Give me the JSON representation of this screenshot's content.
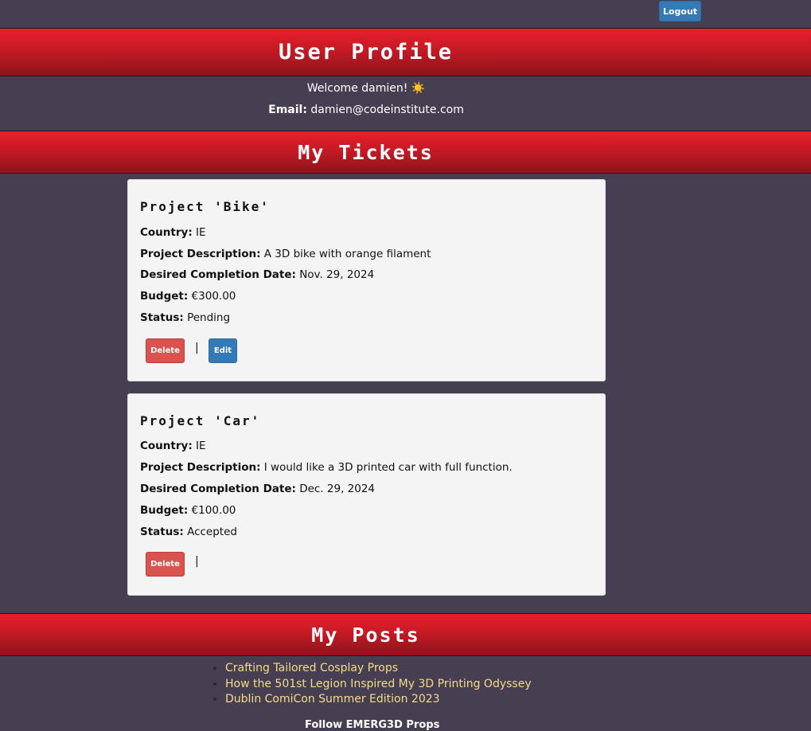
{
  "topbar": {
    "logout_label": "Logout"
  },
  "profile": {
    "title": "User Profile",
    "welcome": "Welcome damien! ☀️",
    "email_label": "Email:",
    "email_value": "damien@codeinstitute.com"
  },
  "tickets": {
    "title": "My Tickets",
    "labels": {
      "country": "Country:",
      "description": "Project Description:",
      "date": "Desired Completion Date:",
      "budget": "Budget:",
      "status": "Status:"
    },
    "separator": "|",
    "delete_label": "Delete",
    "edit_label": "Edit",
    "items": [
      {
        "title": "Project 'Bike'",
        "country": "IE",
        "description": "A 3D bike with orange filament",
        "date": "Nov. 29, 2024",
        "budget": "€300.00",
        "status": "Pending"
      },
      {
        "title": "Project 'Car'",
        "country": "IE",
        "description": "I would like a 3D printed car with full function.",
        "date": "Dec. 29, 2024",
        "budget": "€100.00",
        "status": "Accepted"
      }
    ]
  },
  "posts": {
    "title": "My Posts",
    "items": [
      "Crafting Tailored Cosplay Props",
      "How the 501st Legion Inspired My 3D Printing Odyssey",
      "Dublin ComiCon Summer Edition 2023"
    ]
  },
  "footer": {
    "follow_text": "Follow EMERG3D Props"
  },
  "colors": {
    "background": "#463f51",
    "banner_red": "#c51a25",
    "primary_button": "#337ab7",
    "danger_button": "#d9534f",
    "post_link": "#f6d98a",
    "card_background": "#f4f4f4"
  }
}
